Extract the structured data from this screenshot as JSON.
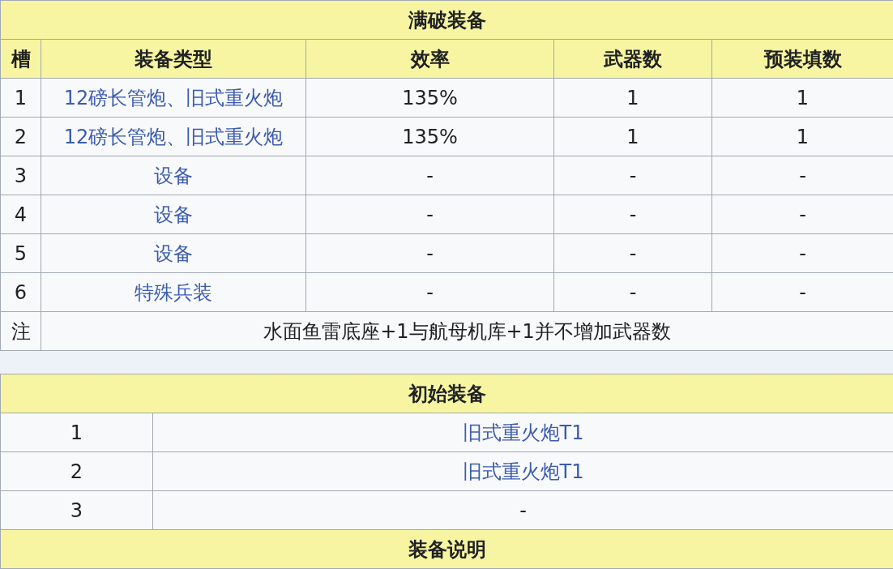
{
  "full_break_equipment": {
    "title": "满破装备",
    "columns": [
      "槽",
      "装备类型",
      "效率",
      "武器数",
      "预装填数"
    ],
    "rows": [
      {
        "slot": "1",
        "type": "12磅长管炮、旧式重火炮",
        "efficiency": "135%",
        "weapons": "1",
        "preload": "1"
      },
      {
        "slot": "2",
        "type": "12磅长管炮、旧式重火炮",
        "efficiency": "135%",
        "weapons": "1",
        "preload": "1"
      },
      {
        "slot": "3",
        "type": "设备",
        "efficiency": "-",
        "weapons": "-",
        "preload": "-"
      },
      {
        "slot": "4",
        "type": "设备",
        "efficiency": "-",
        "weapons": "-",
        "preload": "-"
      },
      {
        "slot": "5",
        "type": "设备",
        "efficiency": "-",
        "weapons": "-",
        "preload": "-"
      },
      {
        "slot": "6",
        "type": "特殊兵装",
        "efficiency": "-",
        "weapons": "-",
        "preload": "-"
      }
    ],
    "note": {
      "label": "注",
      "text": "水面鱼雷底座+1与航母机库+1并不增加武器数"
    }
  },
  "initial_equipment": {
    "title": "初始装备",
    "rows": [
      {
        "slot": "1",
        "item": "旧式重火炮T1",
        "kind": "link"
      },
      {
        "slot": "2",
        "item": "旧式重火炮T1",
        "kind": "link"
      },
      {
        "slot": "3",
        "item": "-",
        "kind": "text"
      }
    ]
  },
  "equipment_notes": {
    "title": "装备说明"
  }
}
